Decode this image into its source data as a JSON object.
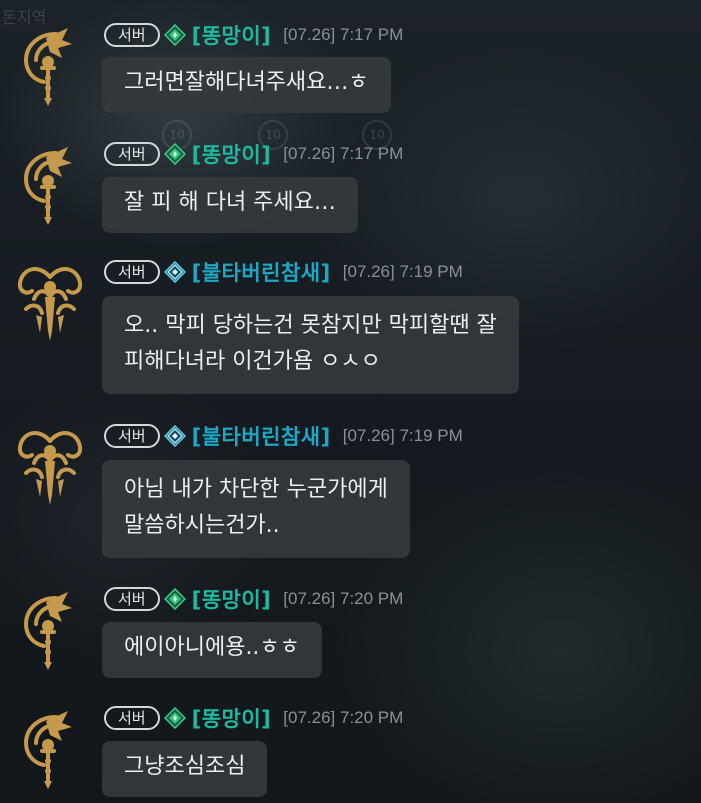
{
  "background": {
    "label": "돈지역",
    "badges": [
      "10",
      "10",
      "10"
    ]
  },
  "colors": {
    "nick_ttong": "#1fb8a0",
    "nick_bul": "#1ea7c4",
    "avatar_gold": "#c69a4c"
  },
  "messages": [
    {
      "server": "서버",
      "nickname": "[똥망이]",
      "date": "[07.26]",
      "time": "7:17 PM",
      "avatar": "staff-emblem-icon",
      "rank_icon": "green-rank-icon",
      "lines": [
        "그러면잘해다녀주새요…ㅎ"
      ]
    },
    {
      "server": "서버",
      "nickname": "[똥망이]",
      "date": "[07.26]",
      "time": "7:17 PM",
      "avatar": "staff-emblem-icon",
      "rank_icon": "green-rank-icon",
      "lines": [
        "잘 피 해  다녀  주세요…"
      ]
    },
    {
      "server": "서버",
      "nickname": "[불타버린참새]",
      "date": "[07.26]",
      "time": "7:19 PM",
      "avatar": "tribal-emblem-icon",
      "rank_icon": "cyan-rank-icon",
      "lines": [
        "오.. 막피 당하는건 못참지만 막피할땐 잘",
        "피해다녀라 이건가욤 ㅇㅅㅇ"
      ]
    },
    {
      "server": "서버",
      "nickname": "[불타버린참새]",
      "date": "[07.26]",
      "time": "7:19 PM",
      "avatar": "tribal-emblem-icon",
      "rank_icon": "cyan-rank-icon",
      "lines": [
        "아님 내가 차단한 누군가에게",
        "말씀하시는건가.."
      ]
    },
    {
      "server": "서버",
      "nickname": "[똥망이]",
      "date": "[07.26]",
      "time": "7:20 PM",
      "avatar": "staff-emblem-icon",
      "rank_icon": "green-rank-icon",
      "lines": [
        "에이아니에용..ㅎㅎ"
      ]
    },
    {
      "server": "서버",
      "nickname": "[똥망이]",
      "date": "[07.26]",
      "time": "7:20 PM",
      "avatar": "staff-emblem-icon",
      "rank_icon": "green-rank-icon",
      "lines": [
        "그냥조심조심"
      ]
    }
  ]
}
